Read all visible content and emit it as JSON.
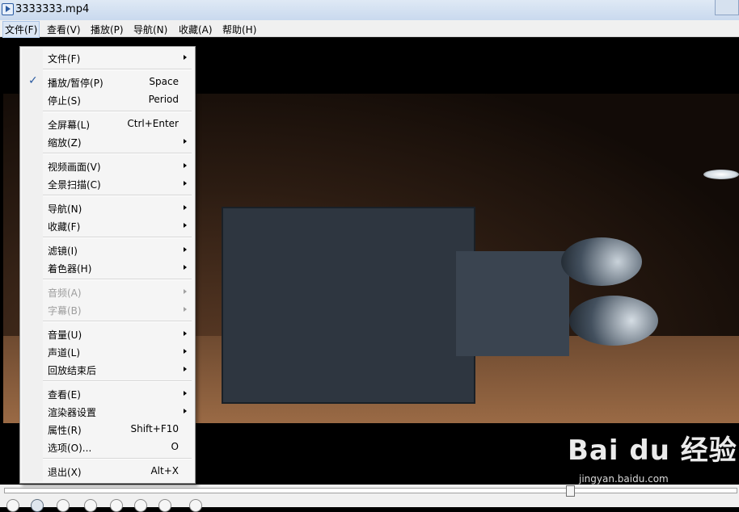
{
  "window": {
    "title": "3333333.mp4"
  },
  "menubar": [
    "文件(F)",
    "查看(V)",
    "播放(P)",
    "导航(N)",
    "收藏(A)",
    "帮助(H)"
  ],
  "popup_menu": {
    "items": [
      {
        "label": "文件(F)",
        "shortcut": "",
        "submenu": true,
        "checked": false,
        "disabled": false
      },
      {
        "label": "播放/暂停(P)",
        "shortcut": "Space",
        "submenu": false,
        "checked": true,
        "disabled": false
      },
      {
        "label": "停止(S)",
        "shortcut": "Period",
        "submenu": false,
        "checked": false,
        "disabled": false
      },
      {
        "label": "全屏幕(L)",
        "shortcut": "Ctrl+Enter",
        "submenu": false,
        "checked": false,
        "disabled": false
      },
      {
        "label": "缩放(Z)",
        "shortcut": "",
        "submenu": true,
        "checked": false,
        "disabled": false
      },
      {
        "label": "视频画面(V)",
        "shortcut": "",
        "submenu": true,
        "checked": false,
        "disabled": false
      },
      {
        "label": "全景扫描(C)",
        "shortcut": "",
        "submenu": true,
        "checked": false,
        "disabled": false
      },
      {
        "label": "导航(N)",
        "shortcut": "",
        "submenu": true,
        "checked": false,
        "disabled": false
      },
      {
        "label": "收藏(F)",
        "shortcut": "",
        "submenu": true,
        "checked": false,
        "disabled": false
      },
      {
        "label": "滤镜(I)",
        "shortcut": "",
        "submenu": true,
        "checked": false,
        "disabled": false
      },
      {
        "label": "着色器(H)",
        "shortcut": "",
        "submenu": true,
        "checked": false,
        "disabled": false
      },
      {
        "label": "音频(A)",
        "shortcut": "",
        "submenu": true,
        "checked": false,
        "disabled": true
      },
      {
        "label": "字幕(B)",
        "shortcut": "",
        "submenu": true,
        "checked": false,
        "disabled": true
      },
      {
        "label": "音量(U)",
        "shortcut": "",
        "submenu": true,
        "checked": false,
        "disabled": false
      },
      {
        "label": "声道(L)",
        "shortcut": "",
        "submenu": true,
        "checked": false,
        "disabled": false
      },
      {
        "label": "回放结束后",
        "shortcut": "",
        "submenu": true,
        "checked": false,
        "disabled": false
      },
      {
        "label": "查看(E)",
        "shortcut": "",
        "submenu": true,
        "checked": false,
        "disabled": false
      },
      {
        "label": "渲染器设置",
        "shortcut": "",
        "submenu": true,
        "checked": false,
        "disabled": false
      },
      {
        "label": "属性(R)",
        "shortcut": "Shift+F10",
        "submenu": false,
        "checked": false,
        "disabled": false
      },
      {
        "label": "选项(O)...",
        "shortcut": "O",
        "submenu": false,
        "checked": false,
        "disabled": false
      },
      {
        "label": "退出(X)",
        "shortcut": "Alt+X",
        "submenu": false,
        "checked": false,
        "disabled": false
      }
    ]
  },
  "watermark": {
    "main": "Bai du 经验",
    "sub": "jingyan.baidu.com"
  },
  "icons": {
    "app": "media-player-icon",
    "check": "checkmark-icon",
    "submenu": "chevron-right-icon"
  },
  "colors": {
    "accent": "#2a5aa0",
    "menu_bg": "#f5f5f5",
    "disabled_text": "#9d9d9d"
  }
}
